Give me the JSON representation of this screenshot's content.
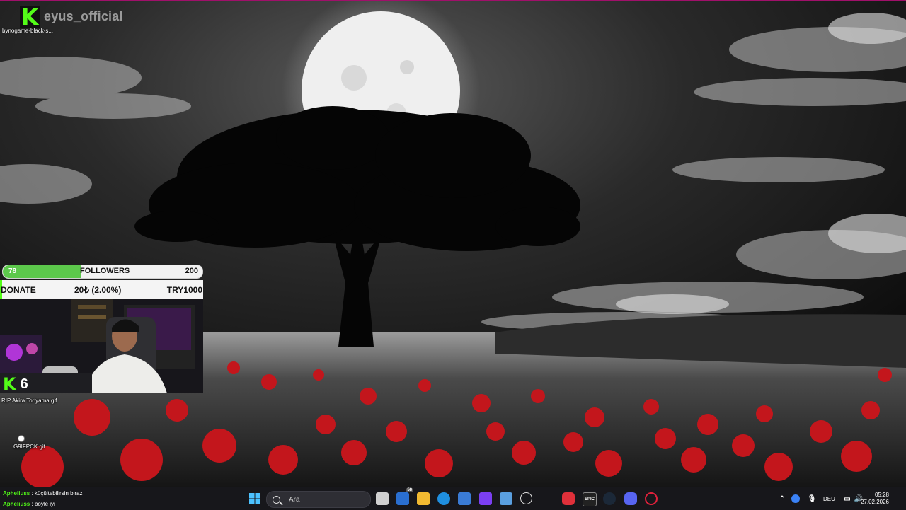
{
  "stream": {
    "channel_name": "eyus_official",
    "top_icon_label": "bynogame-black-s...",
    "viewer_count": "6"
  },
  "followers_goal": {
    "current": "78",
    "label": "FOLLOWERS",
    "target": "200",
    "progress_fraction": 0.39
  },
  "donate_bar": {
    "label": "DONATE",
    "amount": "20₺ (2.00%)",
    "goal": "TRY1000"
  },
  "desktop_icons": [
    {
      "label": "RIP Akira Toriyama.gif"
    },
    {
      "label": "G9IFPCK.gif"
    }
  ],
  "chat": [
    {
      "user": "Apheliuss",
      "message": ": küçültebilirsin biraz"
    },
    {
      "user": "Apheliuss",
      "message": ": böyle iyi"
    }
  ],
  "taskbar": {
    "search_placeholder": "Ara",
    "badge_count": "58",
    "language": "DEU",
    "time": "05:28",
    "date": "27.02.2026",
    "icons": [
      "windows-start-icon",
      "search-icon",
      "task-view-icon",
      "widgets-icon",
      "file-explorer-icon",
      "edge-icon",
      "store-icon",
      "app-grid-icon",
      "browser-icon",
      "chatgpt-icon",
      "red-app-icon",
      "epic-games-icon",
      "steam-icon",
      "discord-icon",
      "opera-gx-icon"
    ]
  },
  "colors": {
    "kick_green": "#53fc18",
    "accent_frame": "#a0106a",
    "taskbar_bg": "#18181c"
  }
}
